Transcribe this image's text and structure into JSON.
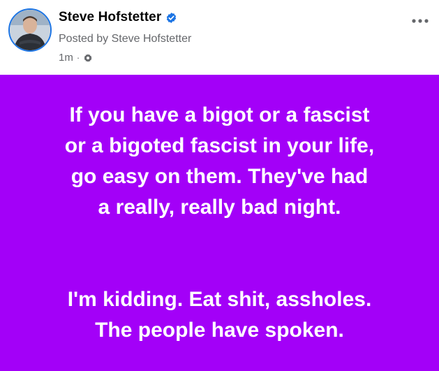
{
  "post": {
    "author": "Steve Hofstetter",
    "verified": true,
    "posted_by": "Posted by Steve Hofstetter",
    "timestamp": "1m",
    "separator": "·",
    "audience_icon": "gear-icon",
    "more_icon": "more-options-icon",
    "background_color": "#a300f8",
    "text_color": "#ffffff",
    "paragraphs": [
      "If you have a bigot or a fascist\nor a bigoted fascist in your life,\ngo easy on them. They've had\na really, really bad night.",
      "I'm kidding. Eat shit, assholes.\nThe people have spoken."
    ]
  }
}
